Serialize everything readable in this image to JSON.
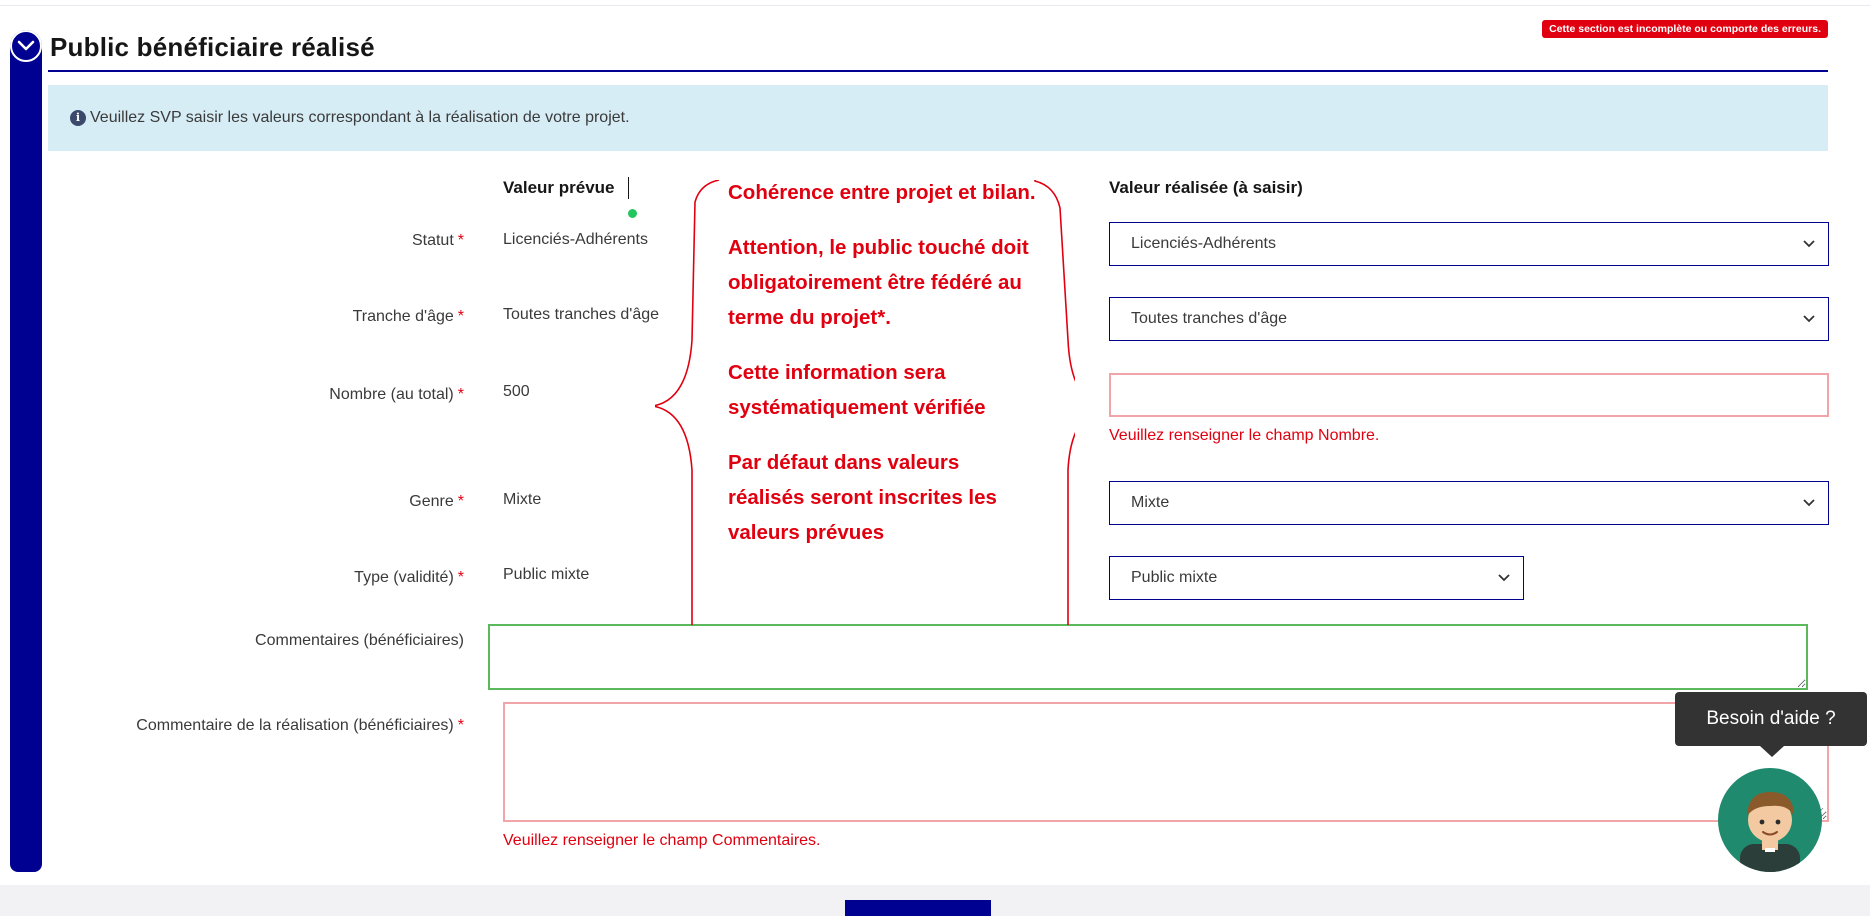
{
  "section": {
    "title": "Public bénéficiaire réalisé",
    "error_badge": "Cette section est incomplète ou comporte des erreurs."
  },
  "info": {
    "icon": "info-icon",
    "text": "Veuillez SVP saisir les valeurs correspondant à la réalisation de votre projet."
  },
  "columns": {
    "planned": "Valeur prévue",
    "realized": "Valeur réalisée (à saisir)"
  },
  "rows": [
    {
      "label": "Statut",
      "required": "*",
      "planned": "Licenciés-Adhérents",
      "realized": "Licenciés-Adhérents"
    },
    {
      "label": "Tranche d'âge",
      "required": "*",
      "planned": "Toutes tranches d'âge",
      "realized": "Toutes tranches d'âge"
    },
    {
      "label": "Nombre (au total)",
      "required": "*",
      "planned": "500",
      "realized": "",
      "error": "Veuillez renseigner le champ Nombre."
    },
    {
      "label": "Genre",
      "required": "*",
      "planned": "Mixte",
      "realized": "Mixte"
    },
    {
      "label": "Type (validité)",
      "required": "*",
      "planned": "Public mixte",
      "realized": "Public mixte"
    }
  ],
  "comments": {
    "beneficiaires_label": "Commentaires (bénéficiaires)",
    "beneficiaires_value": "",
    "realisation_label": "Commentaire de la réalisation (bénéficiaires)",
    "realisation_required": "*",
    "realisation_value": "",
    "realisation_error": "Veuillez renseigner le champ Commentaires."
  },
  "callout": {
    "paragraphs": [
      "Cohérence entre projet et bilan.",
      "Attention, le public touché doit obligatoirement être fédéré au terme du projet*.",
      "Cette information sera systématiquement vérifiée",
      "Par défaut dans valeurs réalisés seront inscrites les valeurs prévues"
    ],
    "color": "#e1000f"
  },
  "help": {
    "tooltip": "Besoin d'aide ?",
    "avatar_icon": "assistant-avatar-icon"
  },
  "colors": {
    "primary": "#000091",
    "error": "#e1000f",
    "info_bg": "#d7edf6",
    "valid": "#5cb85c"
  }
}
